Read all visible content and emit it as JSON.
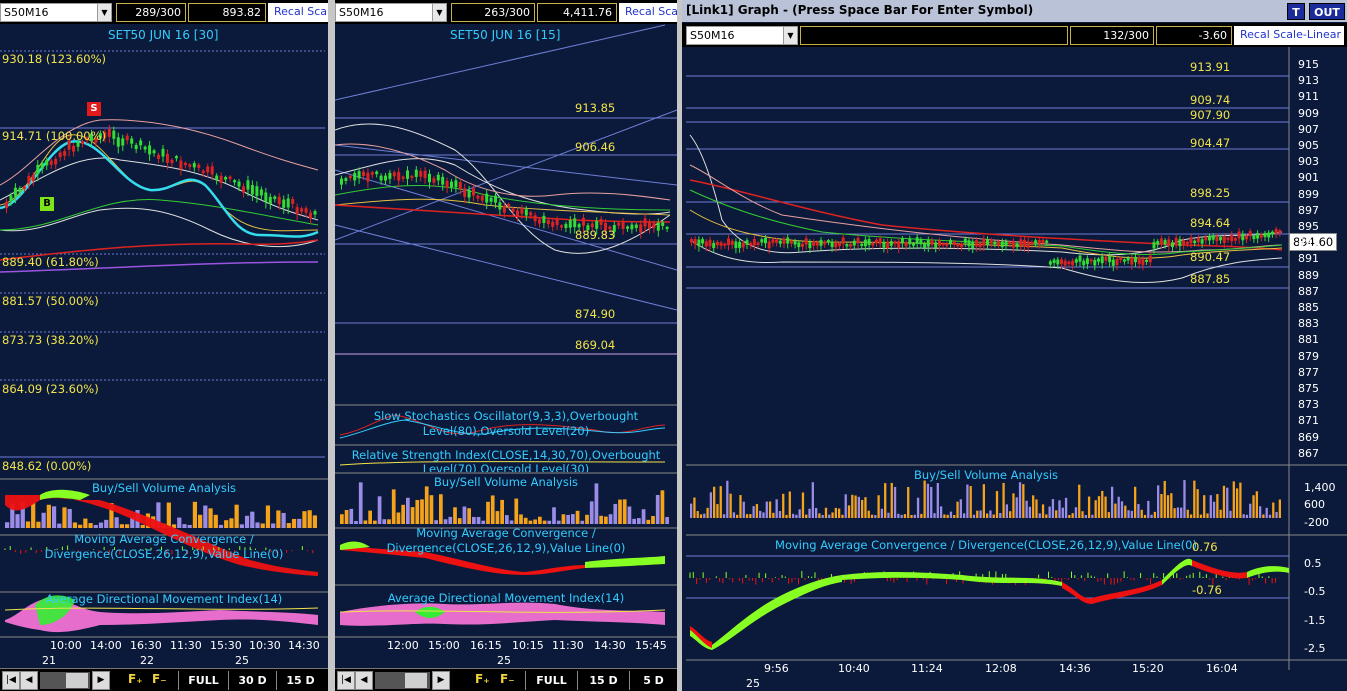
{
  "panel1": {
    "symbol": "S50M16",
    "count": "289/300",
    "value": "893.82",
    "recal": "Recal Scale",
    "title": "SET50 JUN 16  [30]",
    "fib_levels": [
      "930.18 (123.60%)",
      "914.71 (100.00%)",
      "889.40 (61.80%)",
      "881.57 (50.00%)",
      "873.73 (38.20%)",
      "864.09 (23.60%)",
      "848.62 (0.00%)"
    ],
    "sell_badge": "S",
    "buy_badge": "B",
    "sub1": "Buy/Sell Volume Analysis",
    "sub2_l1": "Moving Average Convergence /",
    "sub2_l2": "Divergence(CLOSE,26,12,9),Value Line(0)",
    "sub3": "Average Directional Movement Index(14)",
    "time_ticks": [
      "10:00",
      "14:00",
      "16:30",
      "11:30",
      "15:30",
      "10:30",
      "14:30"
    ],
    "date_ticks": [
      "21",
      "22",
      "25"
    ],
    "buttons": [
      "FULL",
      "30 D",
      "15 D"
    ]
  },
  "panel2": {
    "symbol": "S50M16",
    "count": "263/300",
    "value": "4,411.76",
    "recal": "Recal Scale",
    "title": "SET50 JUN 16  [15]",
    "levels": [
      "913.85",
      "906.46",
      "889.83",
      "874.90",
      "869.04"
    ],
    "sub0_l1": "Slow Stochastics Oscillator(9,3,3),Overbought",
    "sub0_l2": "Level(80),Oversold Level(20)",
    "sub0b_l1": "Relative Strength Index(CLOSE,14,30,70),Overbought",
    "sub0b_l2": "Level(70),Oversold Level(30)",
    "sub1": "Buy/Sell Volume Analysis",
    "sub2_l1": "Moving Average Convergence /",
    "sub2_l2": "Divergence(CLOSE,26,12,9),Value Line(0)",
    "sub3": "Average Directional Movement Index(14)",
    "time_ticks": [
      "12:00",
      "15:00",
      "16:15",
      "10:15",
      "11:30",
      "14:30",
      "15:45"
    ],
    "date_ticks": [
      "25"
    ],
    "buttons": [
      "FULL",
      "15 D",
      "5 D"
    ]
  },
  "panel3": {
    "header": "[Link1] Graph  - (Press Space Bar For Enter Symbol)",
    "btn_t": "T",
    "btn_out": "OUT",
    "symbol": "S50M16",
    "count": "132/300",
    "value": "-3.60",
    "recal": "Recal Scale-Linear",
    "levels": [
      "913.91",
      "909.74",
      "907.90",
      "904.47",
      "898.25",
      "894.64",
      "890.47",
      "887.85"
    ],
    "last_price": "894.60",
    "yaxis": [
      "915",
      "913",
      "911",
      "909",
      "907",
      "905",
      "903",
      "901",
      "899",
      "897",
      "895",
      "893",
      "891",
      "889",
      "887",
      "885",
      "883",
      "881",
      "879",
      "877",
      "875",
      "873",
      "871",
      "869",
      "867"
    ],
    "sub1": "Buy/Sell Volume Analysis",
    "vol_axis": [
      "1,400",
      "600",
      "-200"
    ],
    "sub2": "Moving Average Convergence / Divergence(CLOSE,26,12,9),Value Line(0)",
    "macd_pos": "0.76",
    "macd_neg": "-0.76",
    "macd_axis": [
      "0.5",
      "-0.5",
      "-1.5",
      "-2.5"
    ],
    "time_ticks": [
      "9:56",
      "10:40",
      "11:24",
      "12:08",
      "14:36",
      "15:20",
      "16:04"
    ],
    "date_ticks": [
      "25"
    ]
  },
  "colors": {
    "bg": "#0b1a3a",
    "fib": "#f2e34a",
    "title": "#33ccff",
    "up": "#33dd33",
    "down": "#dd2222",
    "macd_pos": "#88ff22",
    "macd_neg": "#ee1111",
    "vol_buy": "#f5a31a",
    "vol_sell": "#9b8ce8"
  }
}
